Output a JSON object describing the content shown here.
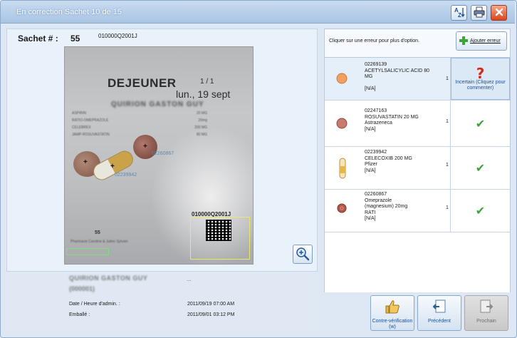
{
  "window": {
    "title": "En correction Sachet 10 de 15"
  },
  "toolbar": {
    "sort_icon": "sort-az-icon",
    "print_icon": "printer-icon",
    "close_icon": "close-icon"
  },
  "sachet": {
    "label": "Sachet # :",
    "number": "55",
    "code": "010000Q2001J"
  },
  "photo": {
    "meal": "DEJEUNER",
    "page": "1  / 1",
    "date": "lun., 19 sept",
    "patient_blurred": "QUIRION GASTON GUY",
    "rows": [
      {
        "name": "ASPIRIN",
        "dose": "20 MG"
      },
      {
        "name": "RATIO-OMEPRAZOLE",
        "dose": "20mg"
      },
      {
        "name": "CELEBREX",
        "dose": "200 MG"
      },
      {
        "name": "JAMP-ROSUVASTATIN",
        "dose": "80 MG"
      }
    ],
    "bottom_code": "010000Q2001J",
    "bag_number": "55",
    "annot_1": "02260867",
    "annot_2": "02239942",
    "footer": "Pharmacie Caroline & Julien Sylvain"
  },
  "info": {
    "patient_name": "QUIRION GASTON GUY",
    "patient_id": "(000001)",
    "dots": "...",
    "admin_label": "Date / Heure d'admin. :",
    "admin_value": "2011/09/19 07:00 AM",
    "packed_label": "Emballé :",
    "packed_value": "2011/09/01 03:12 PM"
  },
  "right": {
    "instruction": "Cliquer sur une erreur pour plus d'option.",
    "add_error_label": "Ajouter erreur",
    "add_error_icon": "plus-icon"
  },
  "medications": [
    {
      "din": "02269139",
      "name": "ACETYLSALICYLIC ACID 80 MG",
      "maker": "",
      "extra": "[N/A]",
      "qty": "1",
      "status": "uncertain",
      "status_text": "Incertain (Cliquez pour commenter)",
      "color": "#f0a060"
    },
    {
      "din": "02247163",
      "name": "ROSUVASTATIN 20 MG",
      "maker": "Astrazeneca",
      "extra": "[N/A]",
      "qty": "1",
      "status": "ok",
      "status_text": "",
      "color": "#c77a6e"
    },
    {
      "din": "02239942",
      "name": "CELECOXIB 200 MG",
      "maker": "Pfizer",
      "extra": "[N/A]",
      "qty": "1",
      "status": "ok",
      "status_text": "",
      "color": "#e6b84a"
    },
    {
      "din": "02260867",
      "name": "Omeprazole (magnesium) 20mg",
      "maker": "RATI",
      "extra": "[N/A]",
      "qty": "1",
      "status": "ok",
      "status_text": "",
      "color": "#b5574a"
    }
  ],
  "buttons": {
    "counter_check": "Contre-vérification (w)",
    "previous": "Précédent",
    "next": "Prochain"
  }
}
